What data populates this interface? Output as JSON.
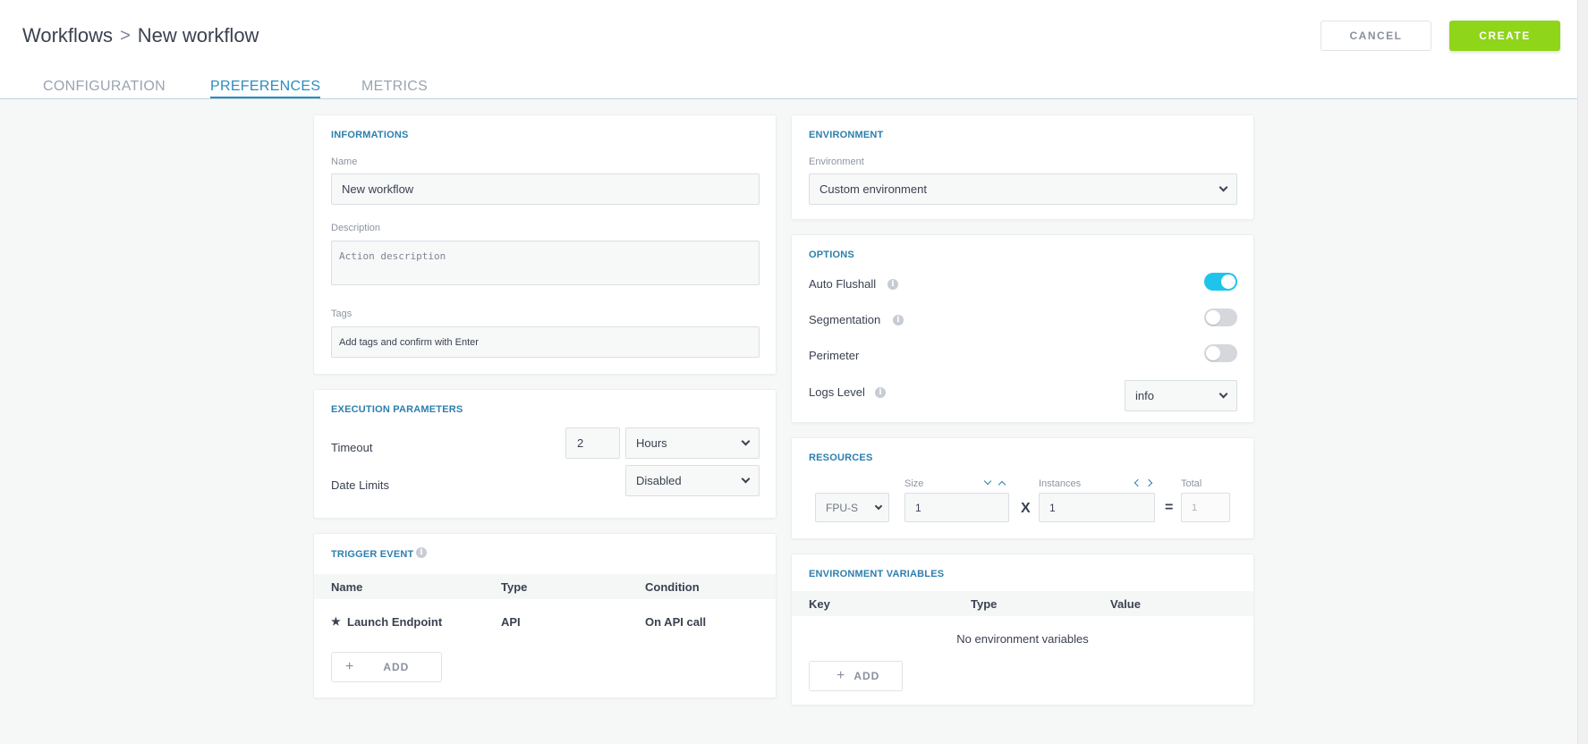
{
  "breadcrumb": {
    "root": "Workflows",
    "separator": ">",
    "current": "New workflow"
  },
  "actions": {
    "cancel": "CANCEL",
    "create": "CREATE"
  },
  "tabs": [
    {
      "label": "CONFIGURATION",
      "active": false
    },
    {
      "label": "PREFERENCES",
      "active": true
    },
    {
      "label": "METRICS",
      "active": false
    }
  ],
  "informations": {
    "title": "INFORMATIONS",
    "name_label": "Name",
    "name_value": "New workflow",
    "description_label": "Description",
    "description_placeholder": "Action description",
    "tags_label": "Tags",
    "tags_placeholder": "Add tags and confirm with Enter"
  },
  "execution": {
    "title": "EXECUTION PARAMETERS",
    "timeout_label": "Timeout",
    "timeout_value": "2",
    "timeout_unit": "Hours",
    "date_limits_label": "Date Limits",
    "date_limits_value": "Disabled"
  },
  "trigger": {
    "title": "TRIGGER EVENT",
    "columns": [
      "Name",
      "Type",
      "Condition"
    ],
    "rows": [
      {
        "name": "Launch Endpoint",
        "type": "API",
        "condition": "On API call"
      }
    ],
    "add_label": "ADD"
  },
  "environment": {
    "title": "ENVIRONMENT",
    "label": "Environment",
    "value": "Custom environment"
  },
  "options": {
    "title": "OPTIONS",
    "auto_flushall": {
      "label": "Auto Flushall",
      "enabled": true
    },
    "segmentation": {
      "label": "Segmentation",
      "enabled": false
    },
    "perimeter": {
      "label": "Perimeter",
      "enabled": false
    },
    "logs_level": {
      "label": "Logs Level",
      "value": "info"
    }
  },
  "resources": {
    "title": "RESOURCES",
    "type_value": "FPU-S",
    "size_label": "Size",
    "size_value": "1",
    "multiply": "X",
    "instances_label": "Instances",
    "instances_value": "1",
    "equals": "=",
    "total_label": "Total",
    "total_value": "1"
  },
  "env_vars": {
    "title": "ENVIRONMENT VARIABLES",
    "columns": [
      "Key",
      "Type",
      "Value"
    ],
    "empty_text": "No environment variables",
    "add_label": "ADD"
  },
  "colors": {
    "accent": "#2c7fae",
    "create": "#8fd51a",
    "toggle_on": "#1fc4ea"
  },
  "icons": [
    "chevron-right-icon",
    "chevron-down-icon",
    "info-icon",
    "star-icon",
    "plus-icon",
    "chevron-up-icon",
    "chevron-left-icon"
  ]
}
